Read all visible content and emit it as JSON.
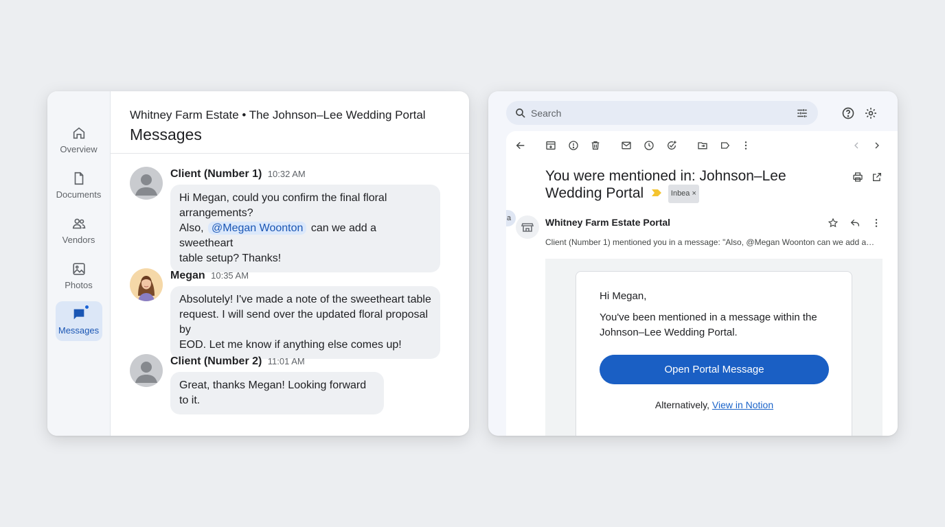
{
  "left_app": {
    "breadcrumb": "Whitney Farm Estate • The Johnson–Lee Wedding Portal",
    "page_title": "Messages",
    "nav": [
      {
        "label": "Overview",
        "icon": "home-icon"
      },
      {
        "label": "Documents",
        "icon": "document-icon"
      },
      {
        "label": "Vendors",
        "icon": "people-icon"
      },
      {
        "label": "Photos",
        "icon": "image-icon"
      },
      {
        "label": "Messages",
        "icon": "chat-icon",
        "active": true,
        "unread": true
      }
    ],
    "messages": [
      {
        "author": "Client (Number 1)",
        "time": "10:32 AM",
        "line1": "Hi Megan, could you confirm the final floral",
        "line2": "arrangements?",
        "line3_pre": "Also,",
        "mention": "@Megan Woonton",
        "line3_post": "can we add a sweetheart",
        "line4": "table setup? Thanks!"
      },
      {
        "author": "Megan",
        "time": "10:35 AM",
        "line1": "Absolutely! I've made a note of the sweetheart table",
        "line2": "request. I will send over the updated floral proposal by",
        "line3": "EOD. Let me know if anything else comes up!"
      },
      {
        "author": "Client (Number 2)",
        "time": "11:01 AM",
        "line1": "Great, thanks Megan! Looking forward to it."
      }
    ]
  },
  "right_app": {
    "search": {
      "placeholder": "Search"
    },
    "subject": "You were mentioned in: Johnson–Lee Wedding Portal",
    "label_chip": "Inbea ×",
    "edge_chip": "a",
    "sender": "Whitney Farm Estate Portal",
    "snippet": "Client (Number 1) mentioned you in a message: \"Also, @Megan Woonton can we add a…",
    "email": {
      "greeting": "Hi Megan,",
      "body": "You've been mentioned in a message within the Johnson–Lee Wedding Portal.",
      "button": "Open Portal Message",
      "alt_prefix": "Alternatively,",
      "alt_link": "View in Notion"
    },
    "colors": {
      "accent": "#1a5fc4",
      "marker": "#f4c430"
    }
  }
}
